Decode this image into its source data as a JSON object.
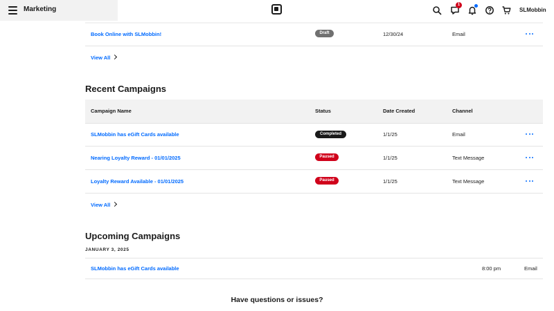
{
  "header": {
    "app_title": "Marketing",
    "notification_count": "1",
    "user_name": "SLMobbin"
  },
  "colors": {
    "link_blue": "#006aff",
    "draft": "#707070",
    "completed": "#1a1a1a",
    "paused": "#d0021b"
  },
  "drafts": {
    "row": {
      "name": "Book Online with SLMobbin!",
      "status": "Draft",
      "date": "12/30/24",
      "channel": "Email"
    },
    "view_all": "View All"
  },
  "recent": {
    "title": "Recent Campaigns",
    "columns": [
      "Campaign Name",
      "Status",
      "Date Created",
      "Channel"
    ],
    "rows": [
      {
        "name": "SLMobbin has eGift Cards available",
        "status": "Completed",
        "date": "1/1/25",
        "channel": "Email"
      },
      {
        "name": "Nearing Loyalty Reward - 01/01/2025",
        "status": "Paused",
        "date": "1/1/25",
        "channel": "Text Message"
      },
      {
        "name": "Loyalty Reward Available - 01/01/2025",
        "status": "Paused",
        "date": "1/1/25",
        "channel": "Text Message"
      }
    ],
    "view_all": "View All"
  },
  "upcoming": {
    "title": "Upcoming Campaigns",
    "date_heading": "JANUARY 3, 2025",
    "row": {
      "name": "SLMobbin has eGift Cards available",
      "time": "8:00 pm",
      "channel": "Email"
    }
  },
  "footer": {
    "question": "Have questions or issues?"
  }
}
